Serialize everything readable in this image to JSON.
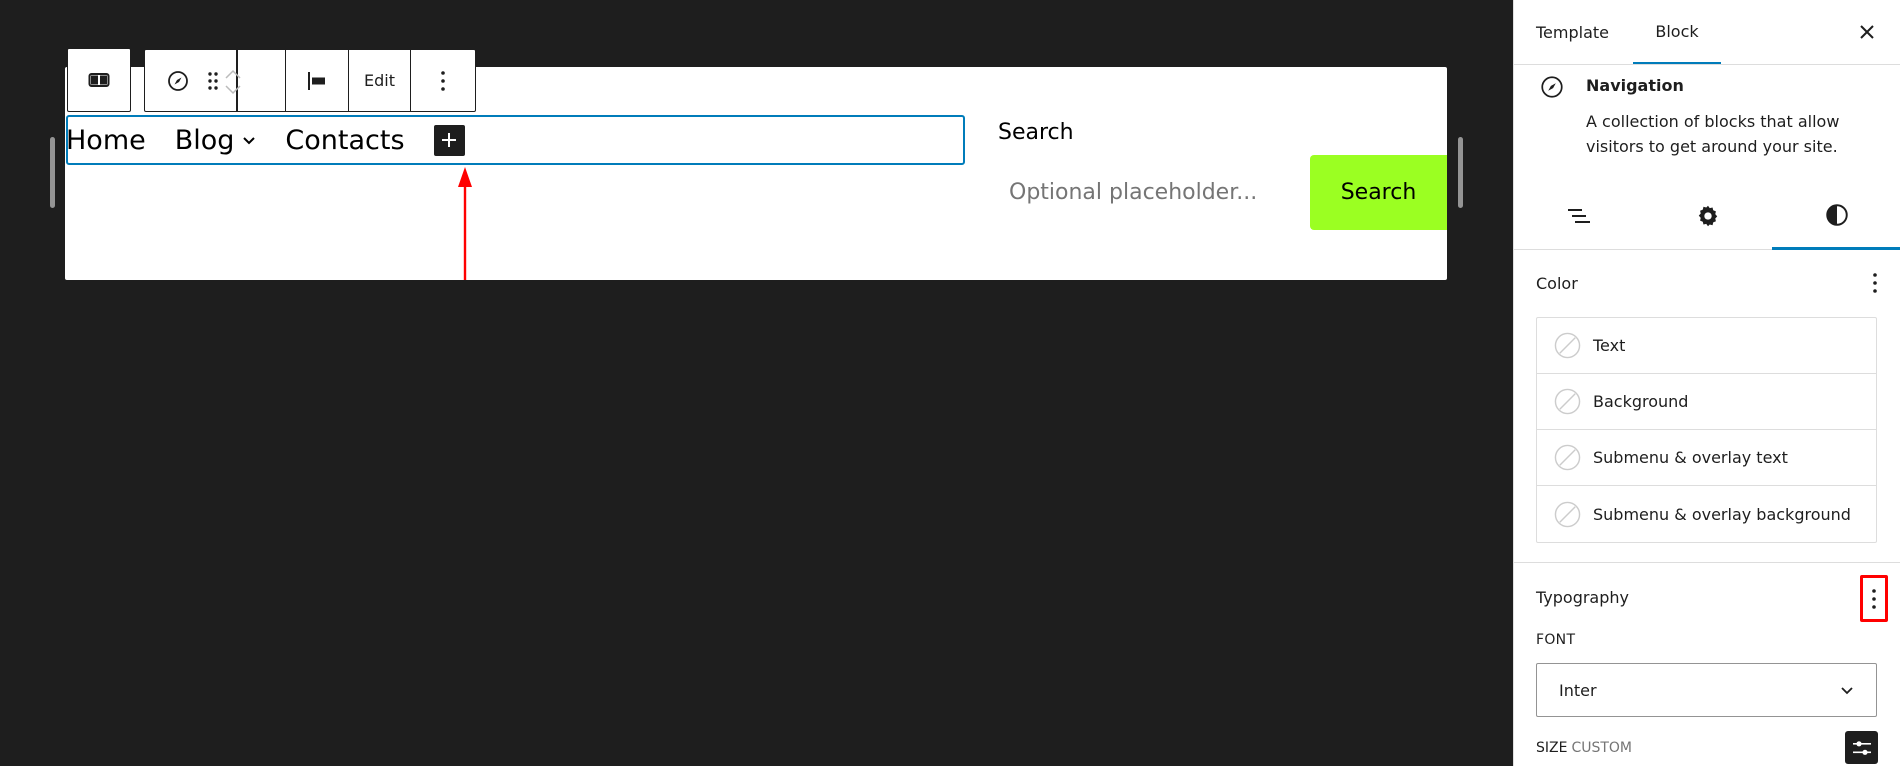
{
  "toolbar": {
    "parent_icon": "columns-icon",
    "block_icon": "navigation-compass-icon",
    "drag_icon": "drag-handle-icon",
    "move_icon": "move-up-down-icon",
    "justify_icon": "justify-left-icon",
    "edit_label": "Edit",
    "options_icon": "more-vertical-icon"
  },
  "navigation": {
    "items": [
      {
        "label": "Home",
        "has_submenu": false
      },
      {
        "label": "Blog",
        "has_submenu": true
      },
      {
        "label": "Contacts",
        "has_submenu": false
      }
    ],
    "add_icon": "plus-icon"
  },
  "search": {
    "label": "Search",
    "placeholder": "Optional placeholder...",
    "button_label": "Search",
    "button_color": "#9bff22"
  },
  "annotations": {
    "arrow_color": "#ff0000",
    "highlight_color": "#ff0000"
  },
  "sidebar": {
    "tabs": [
      {
        "label": "Template",
        "active": false
      },
      {
        "label": "Block",
        "active": true
      }
    ],
    "close_icon": "close-icon",
    "block": {
      "icon": "navigation-compass-icon",
      "title": "Navigation",
      "description": "A collection of blocks that allow visitors to get around your site."
    },
    "subtabs": [
      {
        "name": "list-view",
        "icon": "list-view-icon",
        "active": false
      },
      {
        "name": "settings",
        "icon": "gear-icon",
        "active": false
      },
      {
        "name": "styles",
        "icon": "contrast-icon",
        "active": true
      }
    ],
    "color": {
      "title": "Color",
      "items": [
        {
          "label": "Text"
        },
        {
          "label": "Background"
        },
        {
          "label": "Submenu & overlay text"
        },
        {
          "label": "Submenu & overlay background"
        }
      ]
    },
    "typography": {
      "title": "Typography",
      "font_label": "FONT",
      "font_value": "Inter",
      "size_label": "SIZE",
      "size_mode": "CUSTOM"
    },
    "accent_color": "#007cba"
  }
}
